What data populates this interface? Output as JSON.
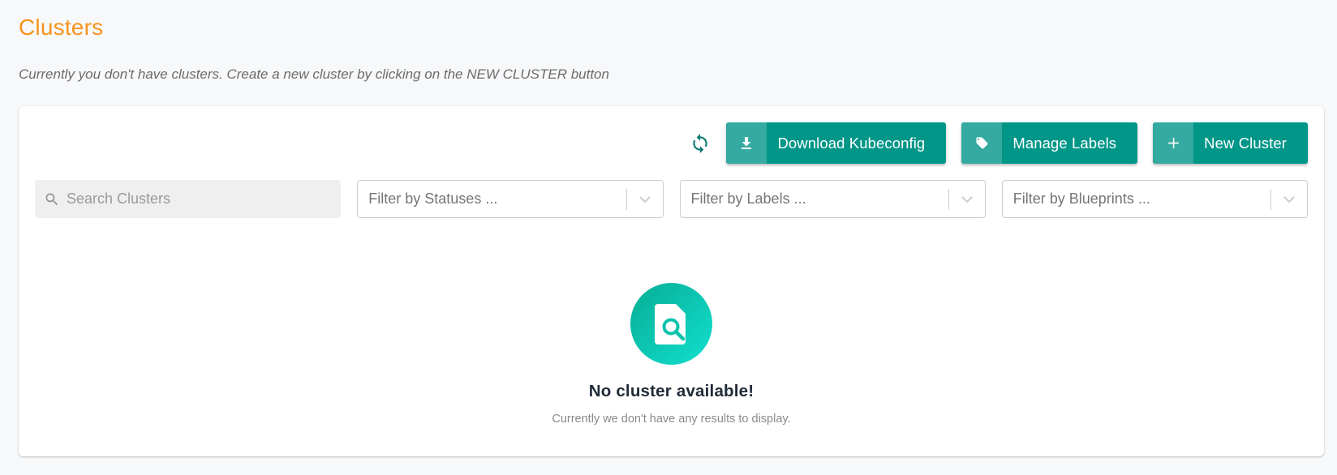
{
  "header": {
    "title": "Clusters",
    "subtitle": "Currently you don't have clusters. Create a new cluster by clicking on the NEW CLUSTER button"
  },
  "toolbar": {
    "refresh_icon": "refresh-icon",
    "buttons": [
      {
        "label": "Download Kubeconfig",
        "icon": "download-icon"
      },
      {
        "label": "Manage Labels",
        "icon": "tag-icon"
      },
      {
        "label": "New Cluster",
        "icon": "plus-icon"
      }
    ]
  },
  "filters": {
    "search": {
      "placeholder": "Search Clusters",
      "value": ""
    },
    "selects": [
      {
        "placeholder": "Filter by Statuses ..."
      },
      {
        "placeholder": "Filter by Labels ..."
      },
      {
        "placeholder": "Filter by Blueprints ..."
      }
    ]
  },
  "empty_state": {
    "icon": "file-search-icon",
    "title": "No cluster available!",
    "text": "Currently we don't have any results to display."
  },
  "colors": {
    "title": "#f7931e",
    "primary": "#009688",
    "primary_icon_bg": "#35aaa0",
    "refresh": "#0b7a73"
  }
}
